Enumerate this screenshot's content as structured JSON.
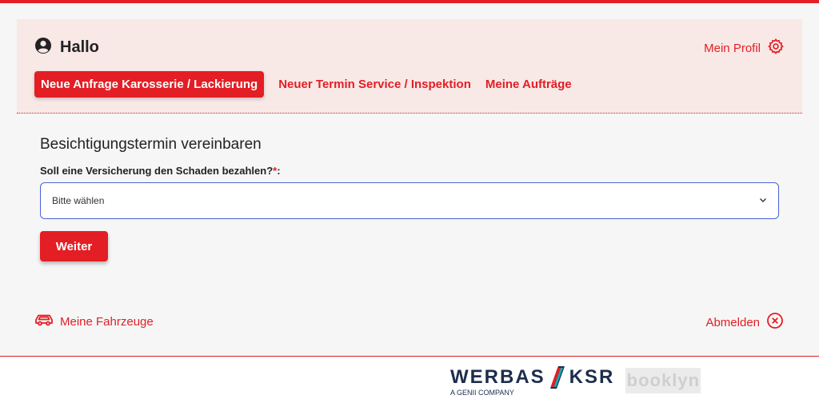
{
  "header": {
    "greeting": "Hallo",
    "profile_label": "Mein Profil",
    "tabs": [
      {
        "label": "Neue Anfrage Karosserie / Lackierung",
        "active": true
      },
      {
        "label": "Neuer Termin Service / Inspektion",
        "active": false
      },
      {
        "label": "Meine Aufträge",
        "active": false
      }
    ]
  },
  "form": {
    "title": "Besichtigungstermin vereinbaren",
    "question_label": "Soll eine Versicherung den Schaden bezahlen?",
    "required_mark": "*",
    "label_suffix": ":",
    "select_value": "Bitte wählen",
    "next_button": "Weiter"
  },
  "footer_links": {
    "vehicles": "Meine Fahrzeuge",
    "logout": "Abmelden"
  },
  "branding": {
    "werbas": "WERBAS",
    "ksr": "KSR",
    "werbas_sub": "A GENII COMPANY",
    "booklyn": "booklyn"
  },
  "colors": {
    "accent": "#e31e24",
    "header_bg": "#f8e8e6",
    "panel_bg": "#f6f6f6",
    "brand_navy": "#1d2d4d"
  },
  "icons": {
    "user": "user-circle-icon",
    "settings": "gear-icon",
    "dropdown": "chevron-down-icon",
    "vehicles": "car-icon",
    "logout": "close-circle-icon"
  }
}
